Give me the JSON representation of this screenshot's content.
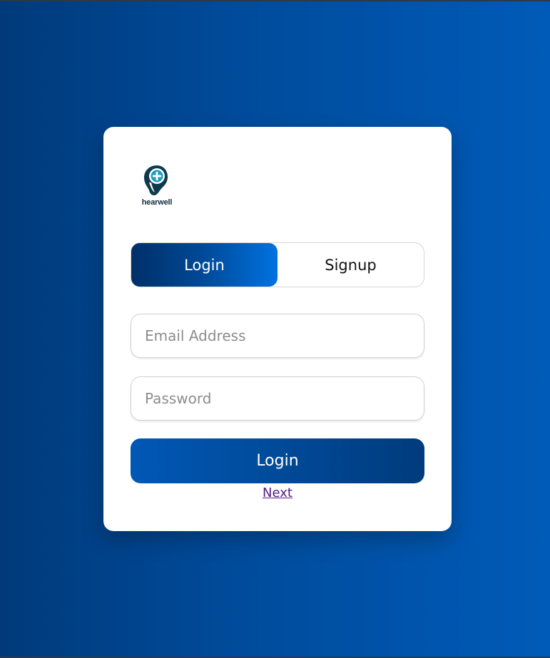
{
  "brand": {
    "name": "hearwell",
    "logo_colors": {
      "dark": "#0f3a4d",
      "accent": "#1a9fc0"
    }
  },
  "tabs": [
    {
      "label": "Login",
      "active": true
    },
    {
      "label": "Signup",
      "active": false
    }
  ],
  "form": {
    "email": {
      "placeholder": "Email Address",
      "value": ""
    },
    "password": {
      "placeholder": "Password",
      "value": ""
    },
    "submit_label": "Login",
    "next_link": "Next"
  },
  "colors": {
    "background_start": "#003a7a",
    "background_end": "#005bb8",
    "card": "#ffffff",
    "link": "#551a8b"
  }
}
